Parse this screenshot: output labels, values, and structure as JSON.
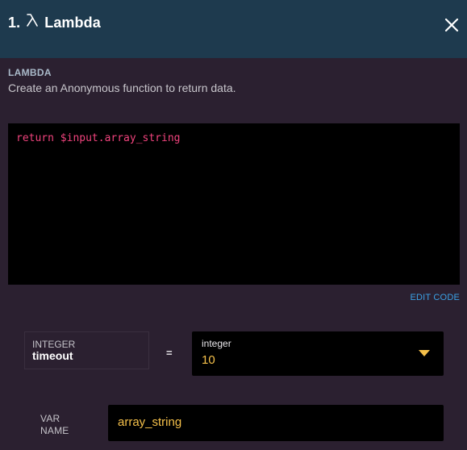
{
  "header": {
    "step_number": "1.",
    "lambda_symbol": "⅄",
    "title": "Lambda",
    "close_symbol": "close-icon"
  },
  "section": {
    "label": "LAMBDA",
    "description": "Create an Anonymous function to return data."
  },
  "code": {
    "line1": "return $input.array_string"
  },
  "edit_code_label": "EDIT CODE",
  "param": {
    "type": "INTEGER",
    "name": "timeout",
    "equals": "=",
    "select_type": "integer",
    "select_value": "10"
  },
  "var_name": {
    "label_line1": "VAR",
    "label_line2": "NAME",
    "value": "array_string"
  },
  "colors": {
    "header_bg": "#1e3a4e",
    "body_bg": "#2b2030",
    "code_text": "#f0437d",
    "accent_yellow": "#f5c04a",
    "link_blue": "#3ba2e6"
  }
}
